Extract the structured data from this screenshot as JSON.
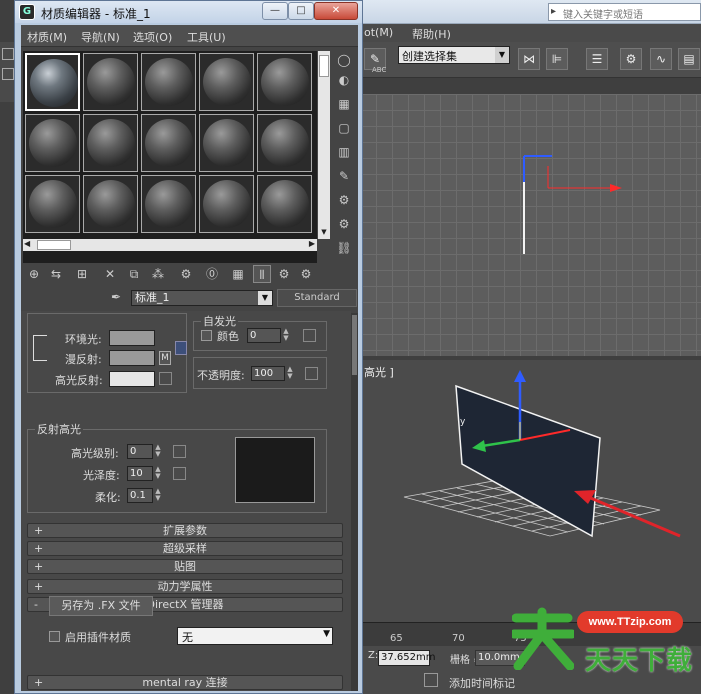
{
  "app": {
    "search_placeholder": "键入关键字或短语",
    "menu": [
      "ot(M)",
      "帮助(H)"
    ],
    "selection_set": "创建选择集",
    "abc": "ABC",
    "viewport_label": "高光 ]",
    "timeline_ticks": [
      "65",
      "70",
      "75"
    ],
    "z_label": "Z:",
    "z_value": "37.652mm",
    "grid_label": "栅格 =",
    "grid_value": "10.0mm",
    "add_time_tag": "添加时间标记"
  },
  "watermark": {
    "url": "www.TTzip.com",
    "cn": "天天下载"
  },
  "material_editor": {
    "title": "材质编辑器 - 标准_1",
    "window_buttons": [
      "—",
      "□",
      "✕"
    ],
    "menu": [
      "材质(M)",
      "导航(N)",
      "选项(O)",
      "工具(U)"
    ],
    "material_name": "标准_1",
    "material_type": "Standard",
    "basic": {
      "ambient": "环境光:",
      "diffuse": "漫反射:",
      "specular": "高光反射:",
      "diffuse_map_btn": "M",
      "self_illum_title": "自发光",
      "color_label": "颜色",
      "color_value": "0",
      "opacity_label": "不透明度:",
      "opacity_value": "100"
    },
    "specular_highlights": {
      "title": "反射高光",
      "level_label": "高光级别:",
      "level_value": "0",
      "gloss_label": "光泽度:",
      "gloss_value": "10",
      "soften_label": "柔化:",
      "soften_value": "0.1"
    },
    "rollouts": [
      {
        "sign": "+",
        "label": "扩展参数"
      },
      {
        "sign": "+",
        "label": "超级采样"
      },
      {
        "sign": "+",
        "label": "贴图"
      },
      {
        "sign": "+",
        "label": "动力学属性"
      },
      {
        "sign": "-",
        "label": "DirectX 管理器"
      }
    ],
    "directx": {
      "save_fx": "另存为 .FX 文件",
      "enable_plugin": "启用插件材质",
      "plugin_value": "无"
    },
    "mental_ray": {
      "sign": "+",
      "label": "mental ray 连接"
    }
  },
  "colors": {
    "ambient_swatch": "#9a9a9a",
    "diffuse_swatch": "#9a9a9a",
    "specular_swatch": "#e6e6e6",
    "highlight_preview": "#1b1b1b",
    "watermark_red": "#e23a2b",
    "watermark_green": "#3fae3a"
  }
}
